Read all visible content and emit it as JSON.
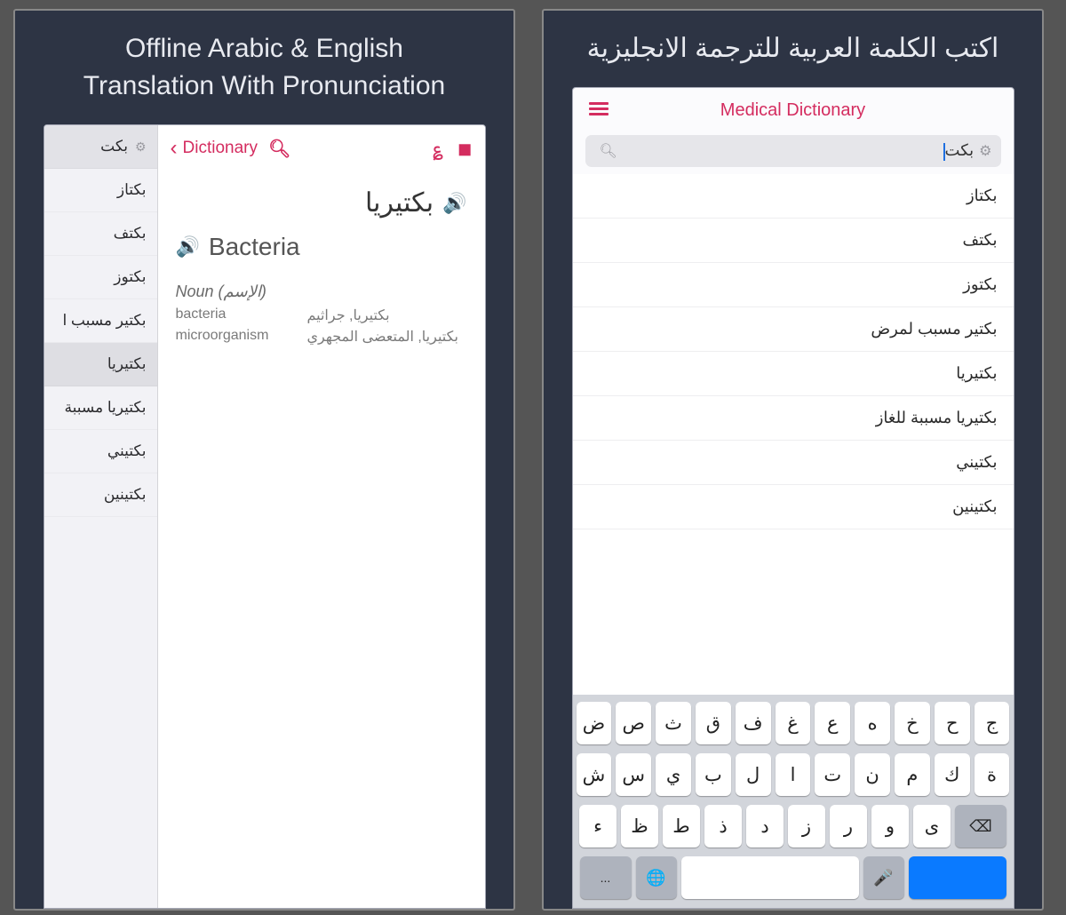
{
  "left": {
    "promo": "Offline Arabic & English\nTranslation With Pronunciation",
    "topbar": {
      "back_label": "Dictionary"
    },
    "side_query": "بكت",
    "side_items": [
      "بكتاز",
      "بكتف",
      "بكتوز",
      "بكتير مسبب ا",
      "بكتيريا",
      "بكتيريا مسببة",
      "بكتيني",
      "بكتينين"
    ],
    "selected_index": 4,
    "headword_ar": "بكتيريا",
    "headword_en": "Bacteria",
    "pos_line": "Noun (الإسم)",
    "defs": [
      {
        "en": "bacteria",
        "ar": "بكتيريا, جراثيم"
      },
      {
        "en": "microorganism",
        "ar": "بكتيريا, المتعضى المجهري"
      }
    ]
  },
  "right": {
    "promo": "اكتب الكلمة العربية للترجمة الانجليزية",
    "title": "Medical Dictionary",
    "search_value": "بكت",
    "list": [
      "بكتاز",
      "بكتف",
      "بكتوز",
      "بكتير مسبب لمرض",
      "بكتيريا",
      "بكتيريا مسببة للغاز",
      "بكتيني",
      "بكتينين"
    ],
    "kbd_row1": [
      "ض",
      "ص",
      "ث",
      "ق",
      "ف",
      "غ",
      "ع",
      "ه",
      "خ",
      "ح",
      "ج"
    ],
    "kbd_row2": [
      "ش",
      "س",
      "ي",
      "ب",
      "ل",
      "ا",
      "ت",
      "ن",
      "م",
      "ك",
      "ة"
    ],
    "kbd_row3": [
      "ء",
      "ظ",
      "ط",
      "ذ",
      "د",
      "ز",
      "ر",
      "و",
      "ى"
    ]
  }
}
